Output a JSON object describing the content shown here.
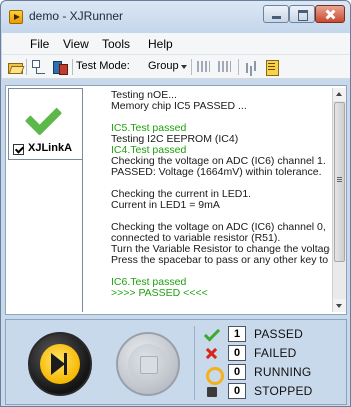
{
  "window": {
    "title": "demo - XJRunner"
  },
  "menubar": {
    "items": [
      "File",
      "View",
      "Tools",
      "Help"
    ]
  },
  "toolbar": {
    "test_mode_label": "Test Mode:",
    "test_mode_value": "Group",
    "icons": [
      "open-folder-icon",
      "tree-icon",
      "chip-icon",
      "grid-icon",
      "grid-icon",
      "bar-chart-icon",
      "report-icon"
    ]
  },
  "tab": {
    "label": "XJLinkA",
    "checked": true
  },
  "log": [
    {
      "text": "Testing nOE...",
      "color": "black"
    },
    {
      "text": "Memory chip IC5 PASSED ...",
      "color": "black"
    },
    {
      "text": "",
      "color": "black"
    },
    {
      "text": "IC5.Test passed",
      "color": "green"
    },
    {
      "text": "Testing I2C EEPROM (IC4)",
      "color": "black"
    },
    {
      "text": "IC4.Test passed",
      "color": "green"
    },
    {
      "text": "Checking the voltage on ADC (IC6) channel 1.",
      "color": "black"
    },
    {
      "text": "PASSED: Voltage (1664mV) within tolerance.",
      "color": "black"
    },
    {
      "text": "",
      "color": "black"
    },
    {
      "text": "Checking the current in LED1.",
      "color": "black"
    },
    {
      "text": "Current in LED1 = 9mA",
      "color": "black"
    },
    {
      "text": "",
      "color": "black"
    },
    {
      "text": "Checking the voltage on ADC (IC6) channel 0,",
      "color": "black"
    },
    {
      "text": "connected to variable resistor (R51).",
      "color": "black"
    },
    {
      "text": "Turn the Variable Resistor to change the voltage",
      "color": "black"
    },
    {
      "text": "Press the spacebar to pass or any other key to fail.",
      "color": "black"
    },
    {
      "text": "",
      "color": "black"
    },
    {
      "text": "IC6.Test passed",
      "color": "green"
    },
    {
      "text": ">>>> PASSED <<<<",
      "color": "green"
    }
  ],
  "status": {
    "passed": {
      "count": "1",
      "label": "PASSED"
    },
    "failed": {
      "count": "0",
      "label": "FAILED"
    },
    "running": {
      "count": "0",
      "label": "RUNNING"
    },
    "stopped": {
      "count": "0",
      "label": "STOPPED"
    }
  },
  "colors": {
    "pass_green": "#3ea92e",
    "fail_red": "#d8261c",
    "running_orange": "#f3b21b",
    "log_green": "#1ea20e"
  }
}
